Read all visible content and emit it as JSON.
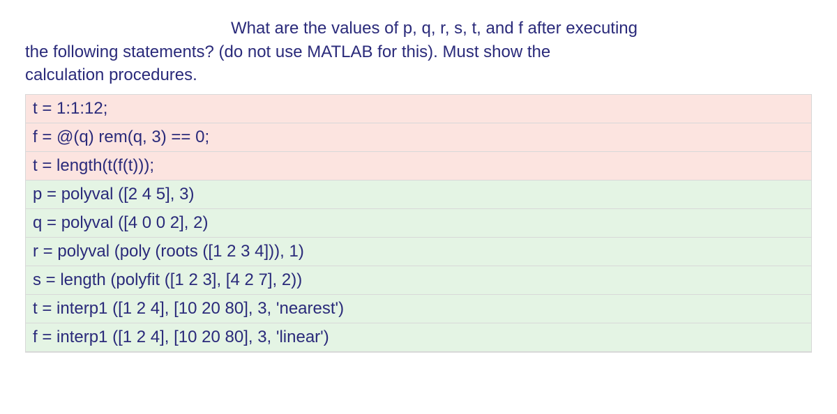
{
  "question": {
    "part1": "What are the values of p, q, r, s, t, and f after executing",
    "part2": "the following statements? (do not use MATLAB for this). Must show the",
    "part3": "calculation procedures."
  },
  "code_lines": [
    {
      "text": "t = 1:1:12;",
      "bg": "pink"
    },
    {
      "text": "f = @(q) rem(q, 3) == 0;",
      "bg": "pink"
    },
    {
      "text": "t = length(t(f(t)));",
      "bg": "pink"
    },
    {
      "text": "p = polyval ([2 4 5], 3)",
      "bg": "green"
    },
    {
      "text": "q = polyval ([4 0 0 2], 2)",
      "bg": "green"
    },
    {
      "text": "r = polyval (poly (roots ([1 2 3 4])), 1)",
      "bg": "green"
    },
    {
      "text": "s = length (polyfit ([1 2 3], [4 2 7], 2))",
      "bg": "green"
    },
    {
      "text": "t = interp1 ([1 2 4], [10 20 80], 3, 'nearest')",
      "bg": "green"
    },
    {
      "text": "f = interp1 ([1 2 4], [10 20 80], 3, 'linear')",
      "bg": "green"
    }
  ]
}
